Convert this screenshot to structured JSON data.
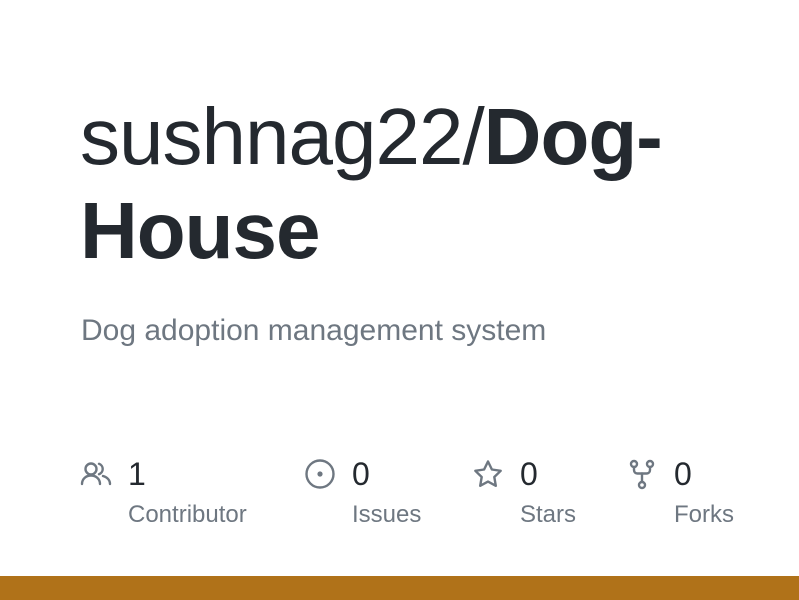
{
  "repo": {
    "owner": "sushnag22/",
    "name": "Dog-House",
    "description": "Dog adoption management system"
  },
  "stats": {
    "contributors": {
      "count": "1",
      "label": "Contributor",
      "icon": "people-icon"
    },
    "issues": {
      "count": "0",
      "label": "Issues",
      "icon": "issue-circle-icon"
    },
    "stars": {
      "count": "0",
      "label": "Stars",
      "icon": "star-icon"
    },
    "forks": {
      "count": "0",
      "label": "Forks",
      "icon": "fork-icon"
    }
  },
  "colors": {
    "text_primary": "#24292f",
    "text_secondary": "#6e7781",
    "accent_bar": "#b07219"
  }
}
